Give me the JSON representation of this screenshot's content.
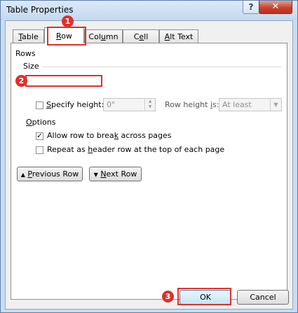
{
  "window": {
    "title": "Table Properties",
    "help_label": "?",
    "close_label": "✕"
  },
  "tabs": [
    {
      "label_pre": "",
      "label_u": "T",
      "label_post": "able"
    },
    {
      "label_pre": "",
      "label_u": "R",
      "label_post": "ow"
    },
    {
      "label_pre": "Col",
      "label_u": "u",
      "label_post": "mn"
    },
    {
      "label_pre": "C",
      "label_u": "e",
      "label_post": "ll"
    },
    {
      "label_pre": "",
      "label_u": "A",
      "label_post": "lt Text"
    }
  ],
  "active_tab": "Row",
  "rows_section": {
    "heading": "Rows",
    "size_heading": "Size",
    "specify_height": {
      "label_pre": "",
      "label_u": "S",
      "label_post": "pecify height:",
      "checked": false
    },
    "height_value": "0\"",
    "row_height_is": {
      "label_pre": "Row height ",
      "label_u": "i",
      "label_post": "s:"
    },
    "row_height_option": "At least",
    "options_heading": {
      "label_pre": "",
      "label_u": "O",
      "label_post": "ptions"
    },
    "allow_break": {
      "label_pre": "Allow row to brea",
      "label_u": "k",
      "label_post": " across pages",
      "checked": true
    },
    "repeat_header": {
      "label_pre": "Repeat as ",
      "label_u": "h",
      "label_post": "eader row at the top of each page",
      "checked": false
    }
  },
  "nav_buttons": {
    "previous": {
      "label_pre": "",
      "label_u": "P",
      "label_post": "revious Row"
    },
    "next": {
      "label_pre": "",
      "label_u": "N",
      "label_post": "ext Row"
    }
  },
  "footer": {
    "ok_label": "OK",
    "cancel_label": "Cancel"
  },
  "annotations": [
    {
      "number": "1"
    },
    {
      "number": "2"
    },
    {
      "number": "3"
    }
  ],
  "colors": {
    "highlight": "#e0302a",
    "titlebar": "#c9dcf2",
    "close_button": "#c7432f"
  }
}
